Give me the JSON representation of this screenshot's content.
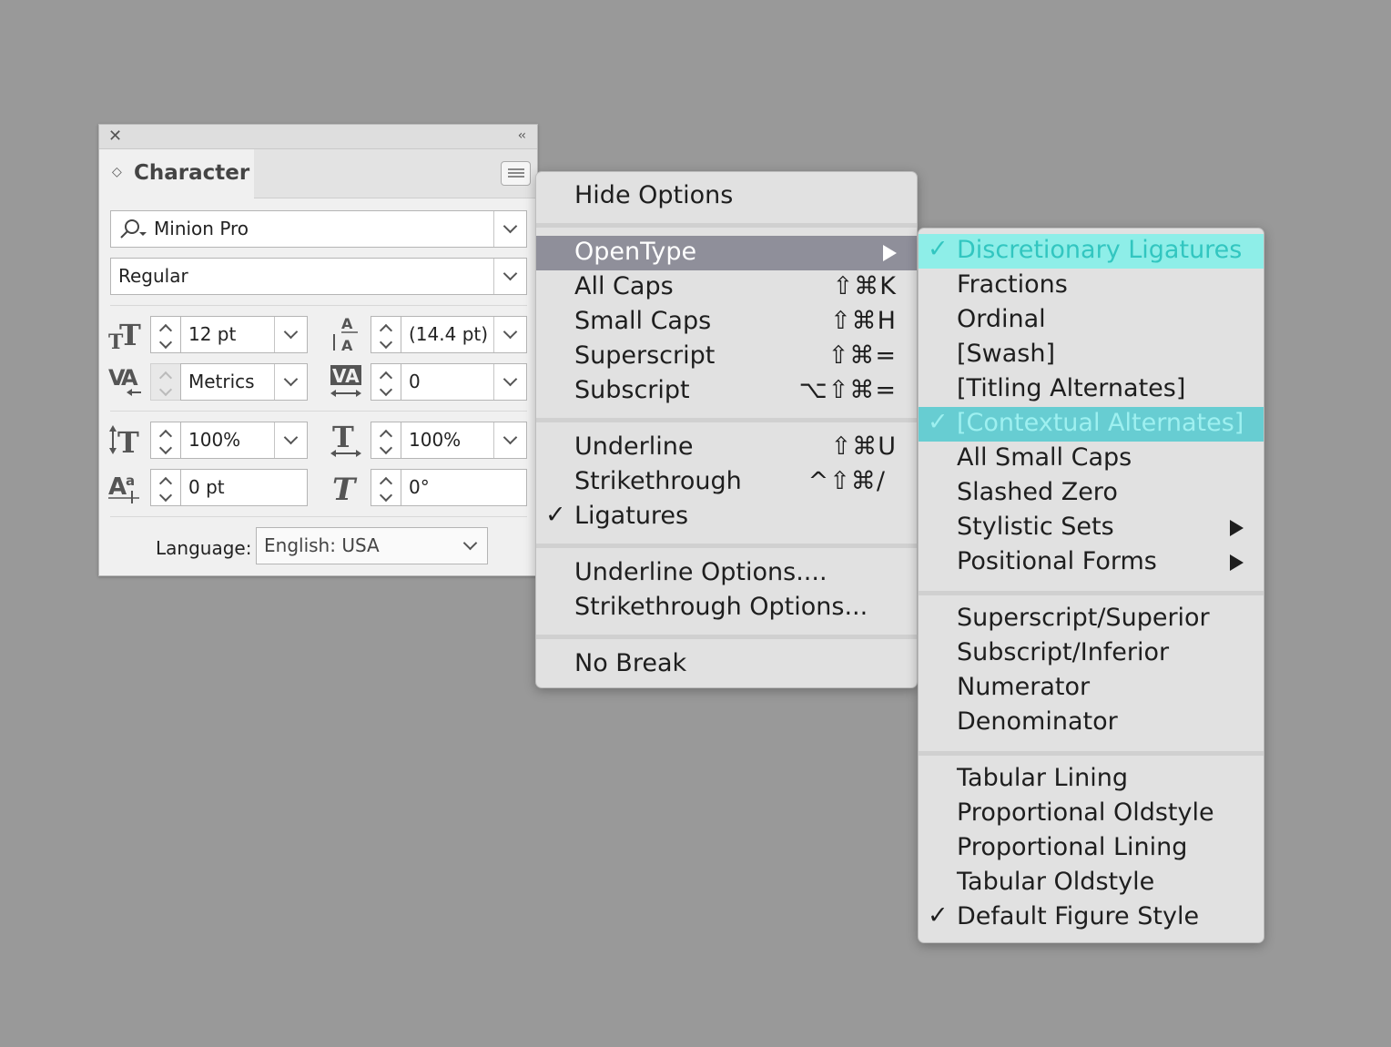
{
  "panel": {
    "title": "Character",
    "font_family": "Minion Pro",
    "font_style": "Regular",
    "font_size": "12 pt",
    "leading": "(14.4 pt)",
    "kerning": "Metrics",
    "tracking": "0",
    "vertical_scale": "100%",
    "horizontal_scale": "100%",
    "baseline_shift": "0 pt",
    "skew": "0°",
    "language_label": "Language:",
    "language_value": "English: USA"
  },
  "menu": {
    "hide_options": "Hide Options",
    "opentype": "OpenType",
    "all_caps": "All Caps",
    "all_caps_sc": "⇧⌘K",
    "small_caps": "Small Caps",
    "small_caps_sc": "⇧⌘H",
    "superscript": "Superscript",
    "superscript_sc": "⇧⌘=",
    "subscript": "Subscript",
    "subscript_sc": "⌥⇧⌘=",
    "underline": "Underline",
    "underline_sc": "⇧⌘U",
    "strikethrough": "Strikethrough",
    "strikethrough_sc": "^⇧⌘/",
    "ligatures": "Ligatures",
    "underline_options": "Underline Options....",
    "strikethrough_options": "Strikethrough Options...",
    "no_break": "No Break"
  },
  "submenu": {
    "discretionary_ligatures": "Discretionary Ligatures",
    "fractions": "Fractions",
    "ordinal": "Ordinal",
    "swash": "[Swash]",
    "titling_alternates": "[Titling Alternates]",
    "contextual_alternates": "[Contextual Alternates]",
    "all_small_caps": "All Small Caps",
    "slashed_zero": "Slashed Zero",
    "stylistic_sets": "Stylistic Sets",
    "positional_forms": "Positional Forms",
    "superscript_superior": "Superscript/Superior",
    "subscript_inferior": "Subscript/Inferior",
    "numerator": "Numerator",
    "denominator": "Denominator",
    "tabular_lining": "Tabular Lining",
    "proportional_oldstyle": "Proportional Oldstyle",
    "proportional_lining": "Proportional Lining",
    "tabular_oldstyle": "Tabular Oldstyle",
    "default_figure_style": "Default Figure Style"
  },
  "glyphs": {
    "check": "✓",
    "close": "✕",
    "collapse": "‹‹",
    "updown": "◇"
  },
  "colors": {
    "highlight_teal": "#8eeee8",
    "teal_text": "#32c6c0",
    "menu_hover": "#8f8f9a"
  }
}
